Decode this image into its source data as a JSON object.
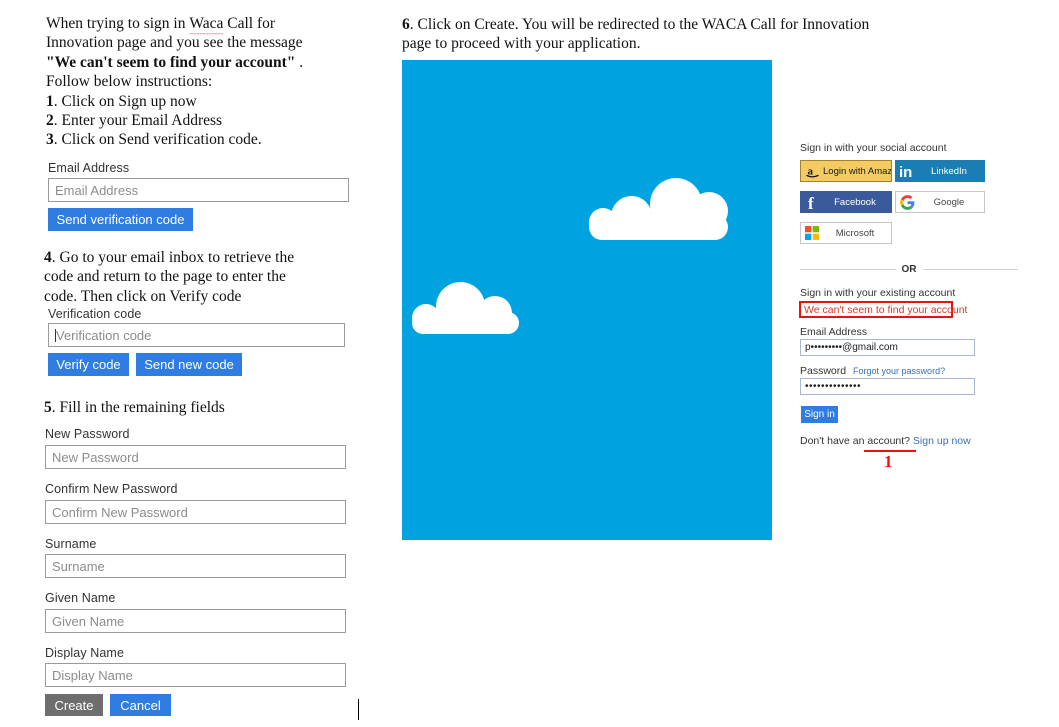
{
  "left_column": {
    "intro": {
      "line1": "When trying to sign in ",
      "misspelled_word": "Waca",
      "line1b": " Call for",
      "line2": "Innovation page and you see the message",
      "quoted_message": "\"We can't seem to find your account\"",
      "period": " .",
      "line4": "Follow below instructions:"
    },
    "steps": [
      {
        "num": "1",
        "text": ". Click on Sign up now"
      },
      {
        "num": "2",
        "text": ". Enter your Email Address"
      },
      {
        "num": "3",
        "text": ". Click on Send verification code."
      }
    ],
    "step4": {
      "num": "4",
      "line1": ". Go to your email inbox to retrieve the",
      "line2": "code and return to the page to enter the",
      "line3": "code. Then click on Verify code"
    },
    "step5": {
      "num": "5",
      "text": ". Fill in the remaining fields"
    },
    "fields": {
      "email_label": "Email Address",
      "email_placeholder": "Email Address",
      "send_verification_code": "Send verification code",
      "verification_label": "Verification code",
      "verification_placeholder": "Verification code",
      "verify_code": "Verify code",
      "send_new_code": "Send new code",
      "new_password_label": "New Password",
      "new_password_placeholder": "New Password",
      "confirm_password_label": "Confirm New Password",
      "confirm_password_placeholder": "Confirm New Password",
      "surname_label": "Surname",
      "surname_placeholder": "Surname",
      "given_name_label": "Given Name",
      "given_name_placeholder": "Given Name",
      "display_name_label": "Display Name",
      "display_name_placeholder": "Display Name",
      "create_button": "Create",
      "cancel_button": "Cancel"
    }
  },
  "right_column": {
    "step6": {
      "num": "6",
      "line1": ". Click on Create. You will be redirected to the WACA Call for Innovation",
      "line2": "page to proceed with your application."
    },
    "hero": {
      "sky_color": "#00a3e0",
      "cloud_color": "#ffffff"
    },
    "signin_panel": {
      "social_heading": "Sign in with your social account",
      "social_buttons": [
        {
          "id": "amazon",
          "label": "Login with Amazon",
          "icon": "amazon-icon",
          "bg": "#f3cb62",
          "fg": "#1a1a1a",
          "border": "#a3832c"
        },
        {
          "id": "linkedin",
          "label": "LinkedIn",
          "icon": "linkedin-icon",
          "bg": "#1a7eb5",
          "fg": "#ffffff",
          "border": "#1a7eb5"
        },
        {
          "id": "facebook",
          "label": "Facebook",
          "icon": "facebook-icon",
          "bg": "#3b5a9b",
          "fg": "#ffffff",
          "border": "#3b5a9b"
        },
        {
          "id": "google",
          "label": "Google",
          "icon": "google-icon",
          "bg": "#ffffff",
          "fg": "#444444",
          "border": "#c7c7c7"
        },
        {
          "id": "microsoft",
          "label": "Microsoft",
          "icon": "microsoft-icon",
          "bg": "#ffffff",
          "fg": "#444444",
          "border": "#c7c7c7"
        }
      ],
      "or_divider": "OR",
      "existing_heading": "Sign in with your existing account",
      "error_message": "We can't seem to find your account",
      "error_border_color": "#e8120e",
      "email_label": "Email Address",
      "email_value": "p•••••••••@gmail.com",
      "password_label": "Password",
      "forgot_password": "Forgot your password?",
      "password_value": "••••••••••••••",
      "signin_button": "Sign in",
      "no_account_text": "Don't have an account?",
      "signup_link": "Sign up now"
    },
    "annotation": {
      "number": "1",
      "color": "#e8120e"
    }
  }
}
